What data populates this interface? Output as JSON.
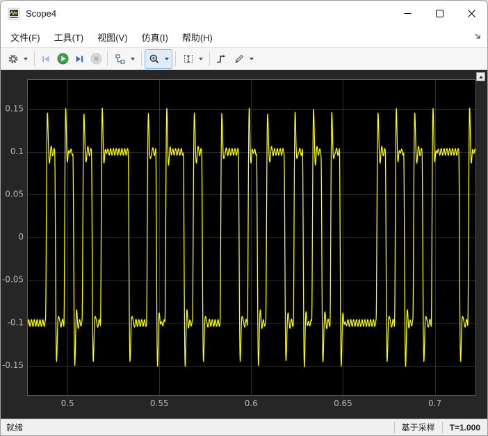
{
  "window": {
    "title": "Scope4"
  },
  "menu": {
    "items": [
      {
        "label": "文件(F)"
      },
      {
        "label": "工具(T)"
      },
      {
        "label": "视图(V)"
      },
      {
        "label": "仿真(I)"
      },
      {
        "label": "帮助(H)"
      }
    ]
  },
  "toolbar": {
    "icons": [
      {
        "name": "settings-gear-icon",
        "dropdown": true
      },
      {
        "name": "step-back-icon",
        "disabled": true
      },
      {
        "name": "run-play-icon"
      },
      {
        "name": "step-forward-icon"
      },
      {
        "name": "stop-icon",
        "disabled": true
      },
      {
        "name": "simulink-hierarchy-icon",
        "dropdown": true
      },
      {
        "name": "zoom-icon",
        "dropdown": true,
        "selected": true
      },
      {
        "name": "fit-to-view-icon",
        "dropdown": true
      },
      {
        "name": "trigger-edge-icon"
      },
      {
        "name": "measurements-icon",
        "dropdown": true
      }
    ]
  },
  "statusbar": {
    "status": "就绪",
    "sample_mode": "基于采样",
    "time": "T=1.000"
  },
  "chart_data": {
    "type": "line",
    "title": "",
    "xlabel": "",
    "ylabel": "",
    "xlim": [
      0.478,
      0.7225
    ],
    "ylim": [
      -0.185,
      0.185
    ],
    "xticks": [
      0.5,
      0.55,
      0.6,
      0.65,
      0.7
    ],
    "yticks": [
      -0.15,
      -0.1,
      -0.05,
      0,
      0.05,
      0.1,
      0.15
    ],
    "grid": true,
    "legend": false,
    "line_color": "#ffff00",
    "axes_bg": "#000000",
    "figure_bg": "#262626",
    "grid_color": "#3d3d3d",
    "axes_border_color": "#5a5a5a",
    "tick_color": "#b8b8b8",
    "signal": {
      "kind": "lowpass-filtered binary waveform (yellow trace)",
      "t_start": 0.478,
      "bit_period": 0.005,
      "levels": [
        -0.1,
        0.1
      ],
      "bits": [
        0,
        0,
        1,
        0,
        1,
        0,
        1,
        0,
        1,
        1,
        1,
        0,
        0,
        1,
        0,
        1,
        1,
        0,
        1,
        0,
        0,
        1,
        1,
        0,
        1,
        0,
        1,
        1,
        0,
        1,
        0,
        1,
        0,
        1,
        0,
        0,
        0,
        0,
        1,
        0,
        1,
        0,
        1,
        0,
        1,
        1,
        1,
        0,
        1,
        0
      ]
    }
  }
}
